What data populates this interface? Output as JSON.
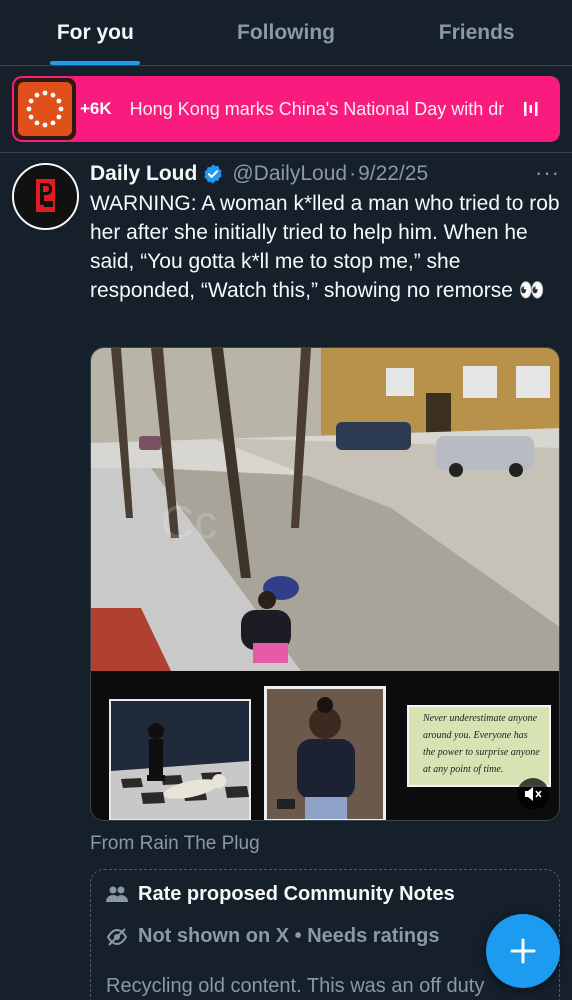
{
  "tabs": [
    {
      "label": "For you",
      "active": true
    },
    {
      "label": "Following",
      "active": false
    },
    {
      "label": "Friends",
      "active": false
    }
  ],
  "trending": {
    "count": "+6K",
    "text": "Hong Kong marks China's National Day with dr",
    "background": "#f91b7d"
  },
  "post": {
    "author_name": "Daily Loud",
    "handle": "@DailyLoud",
    "separator": "·",
    "date": "9/22/25",
    "more": "···",
    "text": "WARNING: A woman k*lled a man who tried to rob her after she initially tried to help him. When he said, “You gotta k*ll me to stop me,” she responded, “Watch this,” showing no remorse 👀",
    "media": {
      "watermark": "Cc",
      "quote_text": "Never underestimate anyone around you. Everyone has the power to surprise anyone at any point of time."
    },
    "source": "From Rain The Plug"
  },
  "community_notes": {
    "title": "Rate proposed Community Notes",
    "status": "Not shown on X • Needs ratings",
    "body": "Recycling old content. This was an off duty"
  },
  "colors": {
    "accent": "#1d9bf0",
    "background": "#15202b",
    "secondary_text": "#8b98a5"
  }
}
